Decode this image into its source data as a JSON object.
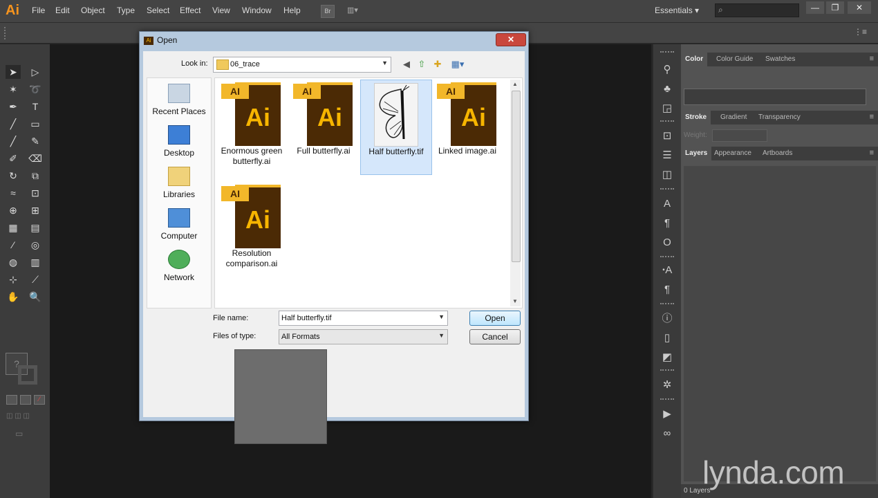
{
  "app": {
    "logo": "Ai"
  },
  "menubar": {
    "items": [
      "File",
      "Edit",
      "Object",
      "Type",
      "Select",
      "Effect",
      "View",
      "Window",
      "Help"
    ],
    "bridge": "Br",
    "workspace": "Essentials ▾"
  },
  "window_controls": {
    "minimize": "—",
    "restore": "❐",
    "close": "✕"
  },
  "panels": {
    "color_tabs": [
      "Color",
      "Color Guide",
      "Swatches"
    ],
    "stroke_tabs": [
      "Stroke",
      "Gradient",
      "Transparency"
    ],
    "weight_label": "Weight:",
    "layers_tabs": [
      "Layers",
      "Appearance",
      "Artboards"
    ],
    "layers_count": "0 Layers"
  },
  "watermark": "lynda.com",
  "dialog": {
    "title": "Open",
    "close": "✕",
    "look_in_label": "Look in:",
    "look_in_value": "06_trace",
    "places": [
      "Recent Places",
      "Desktop",
      "Libraries",
      "Computer",
      "Network"
    ],
    "files": [
      {
        "name": "Enormous green butterfly.ai",
        "type": "ai",
        "selected": false
      },
      {
        "name": "Full butterfly.ai",
        "type": "ai",
        "selected": false
      },
      {
        "name": "Half butterfly.tif",
        "type": "tif",
        "selected": true
      },
      {
        "name": "Linked image.ai",
        "type": "ai",
        "selected": false
      },
      {
        "name": "Resolution comparison.ai",
        "type": "ai",
        "selected": false
      }
    ],
    "file_name_label": "File name:",
    "file_name_value": "Half butterfly.tif",
    "files_of_type_label": "Files of type:",
    "files_of_type_value": "All Formats",
    "open_button": "Open",
    "cancel_button": "Cancel"
  },
  "colors": {
    "accent": "#f7941d",
    "ai_tab": "#f2b72a",
    "ai_doc": "#4b2a05",
    "dialog_frame": "#b5c9de"
  }
}
